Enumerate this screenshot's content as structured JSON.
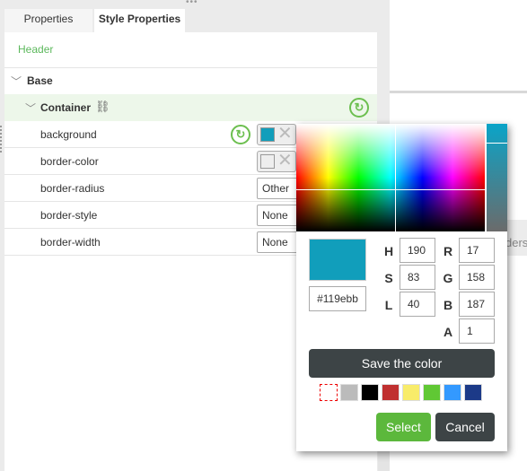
{
  "tabs": [
    {
      "label": "Properties"
    },
    {
      "label": "Style Properties"
    }
  ],
  "header": "Header",
  "section": {
    "label": "Base"
  },
  "group": {
    "label": "Container"
  },
  "rows": [
    {
      "label": "background",
      "type": "color",
      "color": "#119ebb"
    },
    {
      "label": "border-color",
      "type": "color",
      "color": "#eeeeee"
    },
    {
      "label": "border-radius",
      "type": "select",
      "value": "Other"
    },
    {
      "label": "border-style",
      "type": "select",
      "value": "None"
    },
    {
      "label": "border-width",
      "type": "select",
      "value": "None"
    }
  ],
  "right_tab_partial": "ders",
  "picker": {
    "hex": "#119ebb",
    "preview_color": "#119ebb",
    "H": "190",
    "S": "83",
    "L": "40",
    "R": "17",
    "G": "158",
    "B": "187",
    "A": "1",
    "labels": {
      "H": "H",
      "S": "S",
      "L": "L",
      "R": "R",
      "G": "G",
      "B": "B",
      "A": "A"
    },
    "save_label": "Save the color",
    "palette": [
      "transparent",
      "#bbbbbb",
      "#000000",
      "#c03030",
      "#f8ec6a",
      "#60c834",
      "#3399ff",
      "#1c3a88"
    ],
    "select_label": "Select",
    "cancel_label": "Cancel",
    "select_color": "#5cb83c",
    "cancel_color": "#3d4446"
  }
}
